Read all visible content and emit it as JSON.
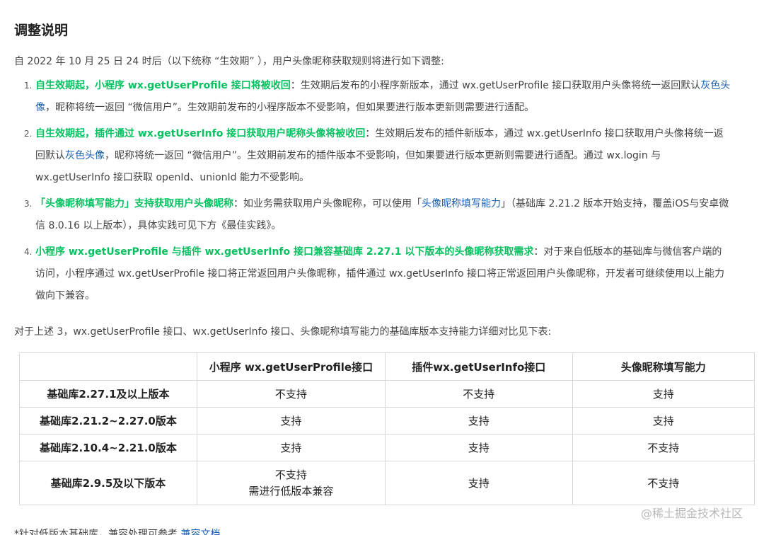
{
  "heading": "调整说明",
  "intro": "自 2022 年 10 月 25 日 24 时后（以下统称 “生效期” ），用户头像昵称获取规则将进行如下调整:",
  "items": [
    {
      "num": "1.",
      "em": "自生效期起，小程序 wx.getUserProfile 接口将被收回",
      "text1": "：生效期后发布的小程序新版本，通过 wx.getUserProfile 接口获取用户头像将统一返回默认",
      "link1": "灰色头像",
      "text2": "，昵称将统一返回 “微信用户”。生效期前发布的小程序版本不受影响，但如果要进行版本更新则需要进行适配。"
    },
    {
      "num": "2.",
      "em": "自生效期起，插件通过 wx.getUserInfo 接口获取用户昵称头像将被收回",
      "text1": "：生效期后发布的插件新版本，通过 wx.getUserInfo 接口获取用户头像将统一返回默认",
      "link1": "灰色头像",
      "text2": "，昵称将统一返回 “微信用户”。生效期前发布的插件版本不受影响，但如果要进行版本更新则需要进行适配。通过 wx.login 与 wx.getUserInfo 接口获取 openId、unionId 能力不受影响。"
    },
    {
      "num": "3.",
      "em": "「头像昵称填写能力」支持获取用户头像昵称",
      "text1": "：如业务需获取用户头像昵称，可以使用「",
      "link1": "头像昵称填写能力",
      "text2": "」（基础库 2.21.2 版本开始支持，覆盖iOS与安卓微信 8.0.16 以上版本），具体实践可见下方《最佳实践》。"
    },
    {
      "num": "4.",
      "em": "小程序 wx.getUserProfile 与插件 wx.getUserInfo 接口兼容基础库 2.27.1 以下版本的头像昵称获取需求",
      "text1": "：对于来自低版本的基础库与微信客户端的访问，小程序通过 wx.getUserProfile 接口将正常返回用户头像昵称，插件通过 wx.getUserInfo 接口将正常返回用户头像昵称，开发者可继续使用以上能力做向下兼容。",
      "link1": "",
      "text2": ""
    }
  ],
  "compare_intro": "对于上述 3，wx.getUserProfile 接口、wx.getUserInfo 接口、头像昵称填写能力的基础库版本支持能力详细对比见下表:",
  "table": {
    "headers": [
      "",
      "小程序 wx.getUserProfile接口",
      "插件wx.getUserInfo接口",
      "头像昵称填写能力"
    ],
    "rows": [
      {
        "label": "基础库2.27.1及以上版本",
        "c1a": "不支持",
        "c1b": "",
        "c2": "不支持",
        "c3": "支持"
      },
      {
        "label": "基础库2.21.2~2.27.0版本",
        "c1a": "支持",
        "c1b": "",
        "c2": "支持",
        "c3": "支持"
      },
      {
        "label": "基础库2.10.4~2.21.0版本",
        "c1a": "支持",
        "c1b": "",
        "c2": "支持",
        "c3": "不支持"
      },
      {
        "label": "基础库2.9.5及以下版本",
        "c1a": "不支持",
        "c1b": "需进行低版本兼容",
        "c2": "支持",
        "c3": "不支持"
      }
    ]
  },
  "footnote": "*针对低版本基础库，兼容处理可参考",
  "footnote_link": "兼容文档",
  "watermark": "@稀土掘金技术社区",
  "colors": {
    "accent_green": "#07c160",
    "link_blue": "#1a5fb4",
    "border": "#d8d8d8"
  }
}
